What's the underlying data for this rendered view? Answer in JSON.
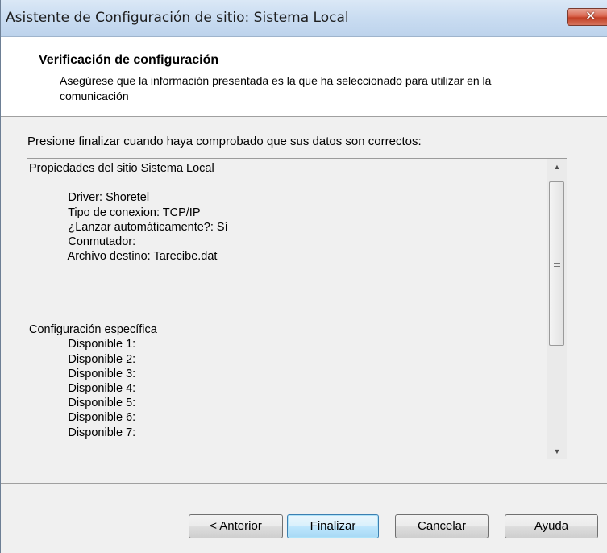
{
  "window": {
    "title": "Asistente de Configuración de sitio: Sistema Local",
    "close_glyph": "✕"
  },
  "header": {
    "title": "Verificación de configuración",
    "description": "Asegúrese que la información presentada es la que ha seleccionado para utilizar en la comunicación"
  },
  "main": {
    "instruction": "Presione finalizar cuando haya comprobado que sus datos son correctos:",
    "summary_text": "Propiedades del sitio Sistema Local\n\n            Driver: Shoretel\n            Tipo de conexion: TCP/IP\n            ¿Lanzar automáticamente?: Sí\n            Conmutador:\n            Archivo destino: Tarecibe.dat\n\n\n\n\nConfiguración específica\n            Disponible 1:\n            Disponible 2:\n            Disponible 3:\n            Disponible 4:\n            Disponible 5:\n            Disponible 6:\n            Disponible 7:"
  },
  "scrollbar": {
    "up_glyph": "▲",
    "down_glyph": "▼"
  },
  "buttons": {
    "back": "< Anterior",
    "finish": "Finalizar",
    "cancel": "Cancelar",
    "help": "Ayuda"
  }
}
